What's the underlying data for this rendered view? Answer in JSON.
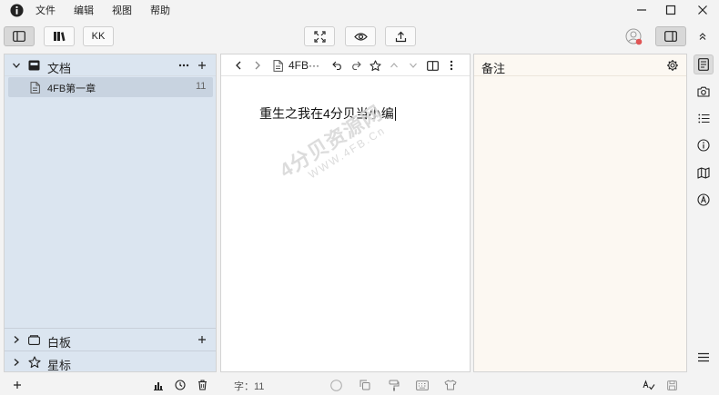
{
  "menu": {
    "items": [
      "文件",
      "编辑",
      "视图",
      "帮助"
    ]
  },
  "toolbar": {
    "kk_label": "KK"
  },
  "left_panel": {
    "title": "文档",
    "doc": {
      "name": "4FB第一章",
      "count": "11"
    },
    "sections": [
      {
        "label": "白板"
      },
      {
        "label": "星标"
      }
    ]
  },
  "editor": {
    "doc_title": "4FB···",
    "content": "重生之我在4分贝当小编"
  },
  "watermark": {
    "main": "4分贝资源网",
    "sub": "WWW.4FB.Cn"
  },
  "notes_panel": {
    "title": "备注"
  },
  "statusbar": {
    "word_count": "字：11"
  },
  "colors": {
    "left_bg": "#dbe5f0",
    "selected_row": "#c8d3e0",
    "notes_bg": "#fcf8f2",
    "avatar_badge": "#e05555"
  }
}
